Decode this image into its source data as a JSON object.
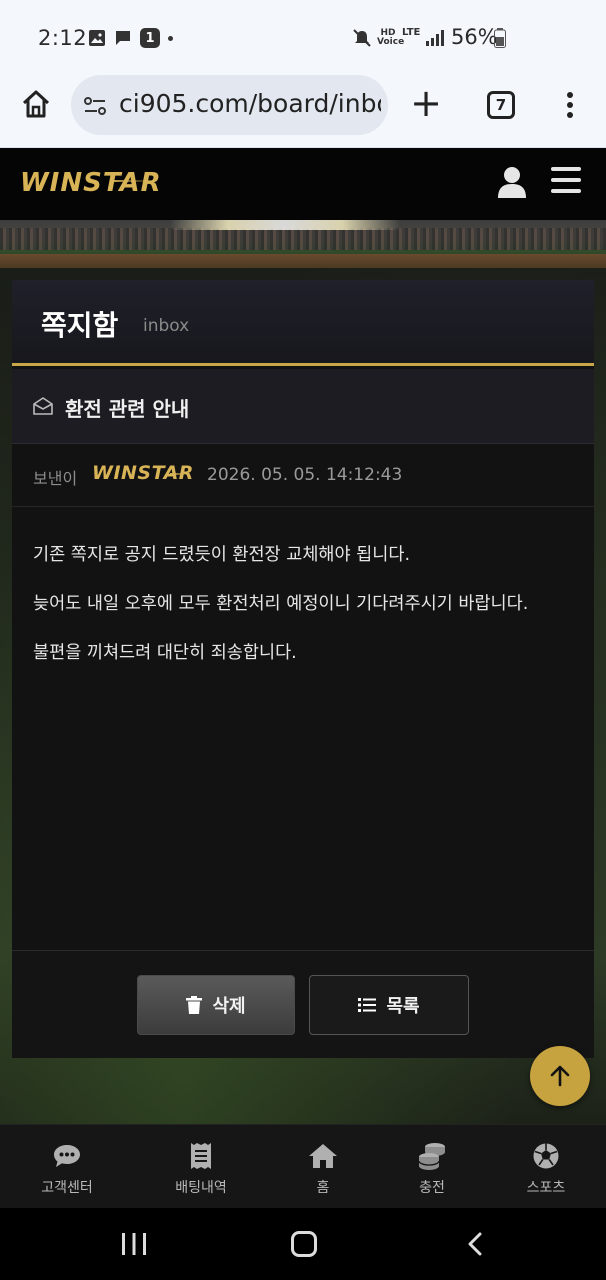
{
  "status_bar": {
    "time": "2:12",
    "notification_count": "1",
    "battery": "56%",
    "network_labels": [
      "HD Voice",
      "LTE"
    ]
  },
  "browser": {
    "url": "ci905.com/board/inbo",
    "tab_count": "7"
  },
  "site": {
    "logo_text": "WINSTAR",
    "panel": {
      "title": "쪽지함",
      "subtitle": "inbox",
      "subject": "환전 관련 안내",
      "sender_label": "보낸이",
      "sender_logo": "WINSTAR",
      "date": "2026. 05. 05. 14:12:43",
      "body": [
        "기존 쪽지로 공지 드렸듯이 환전장 교체해야 됩니다.",
        "늦어도 내일 오후에 모두 환전처리 예정이니 기다려주시기 바랍니다.",
        "불편을 끼쳐드려 대단히 죄송합니다."
      ],
      "delete_label": "삭제",
      "list_label": "목록"
    },
    "bottom_nav": [
      {
        "label": "고객센터",
        "icon": "chat-bubble-icon"
      },
      {
        "label": "배팅내역",
        "icon": "receipt-icon"
      },
      {
        "label": "홈",
        "icon": "home-icon"
      },
      {
        "label": "충전",
        "icon": "coins-icon"
      },
      {
        "label": "스포츠",
        "icon": "soccer-ball-icon"
      }
    ],
    "accent_color": "#c9a64a"
  }
}
